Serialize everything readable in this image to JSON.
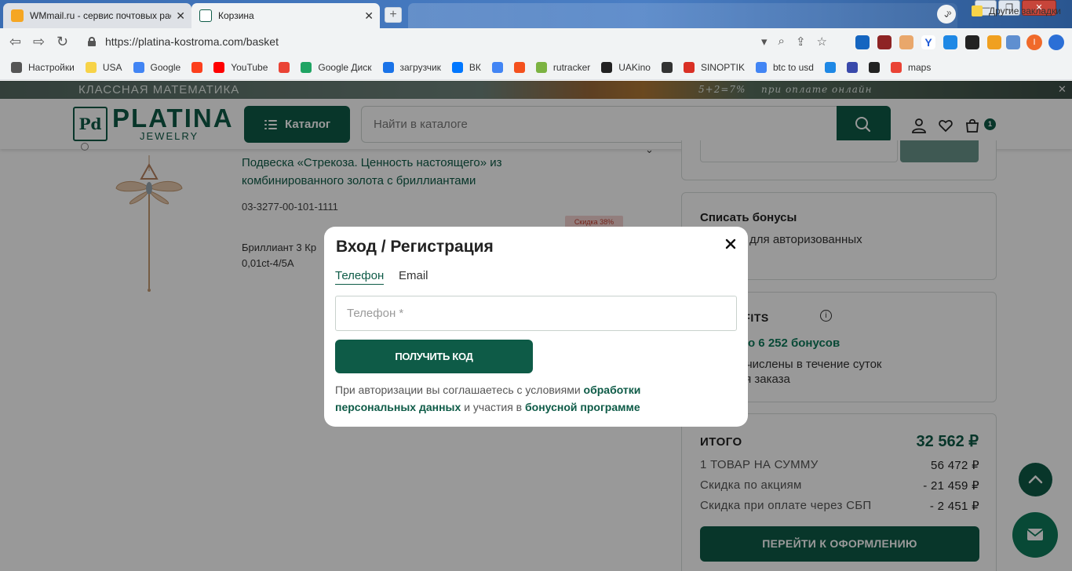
{
  "browser": {
    "tabs": [
      {
        "title": "WMmail.ru - сервис почтовых рассылок"
      },
      {
        "title": "Корзина"
      }
    ],
    "new_tab_symbol": "+",
    "window_controls": [
      "—",
      "❐",
      "✕"
    ],
    "url": "https://platina-kostroma.com/basket",
    "profile_initial": "I",
    "bookmarks": [
      {
        "label": "Настройки",
        "icon": "gear-icon",
        "color": "#555555"
      },
      {
        "label": "USA",
        "icon": "folder-icon",
        "color": "#f7d348"
      },
      {
        "label": "Google",
        "icon": "google-icon",
        "color": "#4285f4"
      },
      {
        "label": "",
        "icon": "yandex-icon",
        "color": "#fc3f1d"
      },
      {
        "label": "YouTube",
        "icon": "youtube-icon",
        "color": "#ff0000"
      },
      {
        "label": "",
        "icon": "gmail-icon",
        "color": "#ea4335"
      },
      {
        "label": "Google Диск",
        "icon": "drive-icon",
        "color": "#1fa463"
      },
      {
        "label": "загрузчик",
        "icon": "loader-icon",
        "color": "#1a73e8"
      },
      {
        "label": "ВК",
        "icon": "vk-icon",
        "color": "#0077ff"
      },
      {
        "label": "",
        "icon": "translate-icon",
        "color": "#4285f4"
      },
      {
        "label": "",
        "icon": "f-icon",
        "color": "#f4511e"
      },
      {
        "label": "rutracker",
        "icon": "rutracker-icon",
        "color": "#7cb342"
      },
      {
        "label": "UAKino",
        "icon": "uakino-icon",
        "color": "#222222"
      },
      {
        "label": "",
        "icon": "chess-icon",
        "color": "#333333"
      },
      {
        "label": "SINOPTIK",
        "icon": "thermometer-icon",
        "color": "#d93025"
      },
      {
        "label": "btc to usd",
        "icon": "google-icon",
        "color": "#4285f4"
      },
      {
        "label": "",
        "icon": "p-icon",
        "color": "#1e88e5"
      },
      {
        "label": "",
        "icon": "arrow-icon",
        "color": "#3949ab"
      },
      {
        "label": "",
        "icon": "bc-icon",
        "color": "#222222"
      },
      {
        "label": "maps",
        "icon": "maps-icon",
        "color": "#ea4335"
      }
    ],
    "bookmarks_more": "»",
    "other_bookmarks": "Другие закладки"
  },
  "promo": {
    "text": "КЛАССНАЯ МАТЕМАТИКА",
    "script1": "5+2=7%",
    "script2": "при оплате онлайн"
  },
  "header": {
    "logo_mark": "Pd",
    "logo_name": "PLATINA",
    "logo_sub": "JEWELRY",
    "catalog_label": "Каталог",
    "search_placeholder": "Найти в каталоге",
    "cart_count": "1"
  },
  "product": {
    "title": "Подвеска «Стрекоза. Ценность настоящего» из комбинированного золота с бриллиантами",
    "sku": "03-3277-00-101-1111",
    "desc_line1": "Бриллиант 3 Кр",
    "desc_line2": "0,01ct-4/5A",
    "discount": "Скидка 38%"
  },
  "bonus": {
    "title": "Списать бонусы",
    "text": "о только для авторизованных\nателей"
  },
  "benefits": {
    "title": "A BENEFITS",
    "info": "i",
    "accrued": "ачислено 6 252 бонусов",
    "note": "будут начислены в течение суток\nолучения заказа"
  },
  "total": {
    "title": "ИТОГО",
    "sum": "32 562 ₽",
    "rows": [
      {
        "label": "1 ТОВАР НА СУММУ",
        "value": "56 472 ₽"
      },
      {
        "label": "Скидка по акциям",
        "value": "- 21 459 ₽"
      },
      {
        "label": "Скидка при оплате через СБП",
        "value": "- 2 451 ₽"
      }
    ],
    "checkout_label": "ПЕРЕЙТИ К ОФОРМЛЕНИЮ"
  },
  "modal": {
    "title": "Вход / Регистрация",
    "tab_phone": "Телефон",
    "tab_email": "Email",
    "phone_placeholder": "Телефон *",
    "submit_label": "ПОЛУЧИТЬ КОД",
    "legal_prefix": "При авторизации вы соглашаетесь с условиями",
    "legal_link1": "обработки персональных данных",
    "legal_middle": "и участия в",
    "legal_link2": "бонусной программе"
  }
}
